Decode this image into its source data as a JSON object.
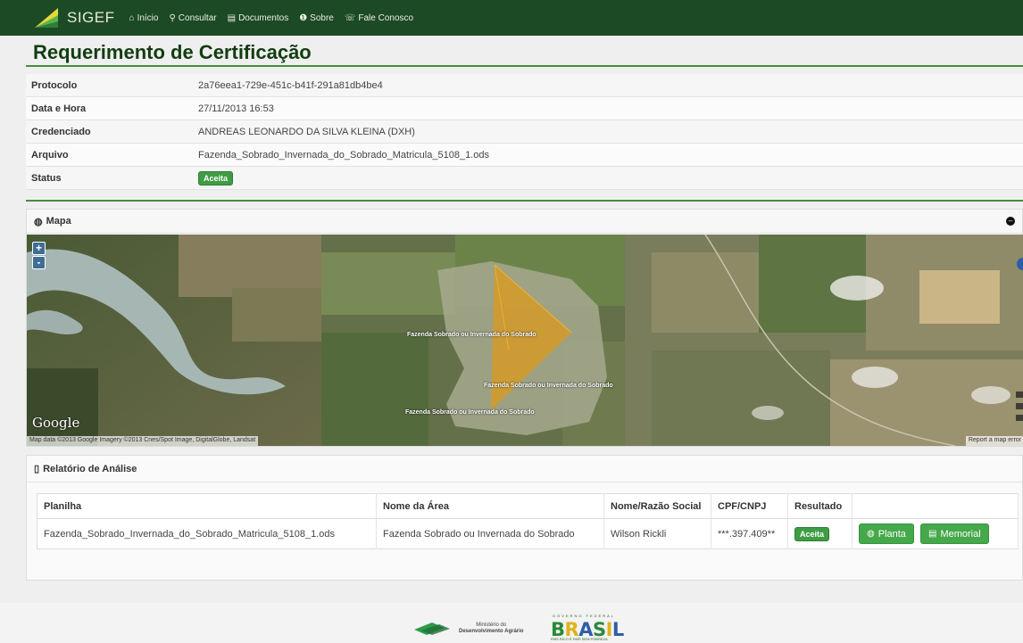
{
  "nav": {
    "brand": "SIGEF",
    "items": [
      {
        "icon": "home-icon",
        "glyph": "⌂",
        "label": "Início"
      },
      {
        "icon": "search-icon",
        "glyph": "⚲",
        "label": "Consultar"
      },
      {
        "icon": "document-icon",
        "glyph": "▤",
        "label": "Documentos"
      },
      {
        "icon": "info-icon",
        "glyph": "❶",
        "label": "Sobre"
      },
      {
        "icon": "phone-icon",
        "glyph": "☏",
        "label": "Fale Conosco"
      }
    ]
  },
  "page_title": "Requerimento de Certificação",
  "info": {
    "protocolo": {
      "label": "Protocolo",
      "value": "2a76eea1-729e-451c-b41f-291a81db4be4"
    },
    "data_hora": {
      "label": "Data e Hora",
      "value": "27/11/2013 16:53"
    },
    "credenciado": {
      "label": "Credenciado",
      "value": "ANDREAS LEONARDO DA SILVA KLEINA (DXH)"
    },
    "arquivo": {
      "label": "Arquivo",
      "value": "Fazenda_Sobrado_Invernada_do_Sobrado_Matricula_5108_1.ods"
    },
    "status": {
      "label": "Status",
      "value": "Aceita"
    }
  },
  "map": {
    "title": "Mapa",
    "zoom_in": "+",
    "zoom_out": "-",
    "google": "Google",
    "credit": "Map data ©2013 Google Imagery ©2013 Cnes/Spot Image, DigitalGlobe, Landsat",
    "report": "Report a map error",
    "labels": [
      "Fazenda Sobrado ou Invernada do Sobrado",
      "Fazenda Sobrado ou Invernada do Sobrado",
      "Fazenda Sobrado ou Invernada do Sobrado"
    ]
  },
  "report": {
    "title": "Relatório de Análise",
    "headers": [
      "Planilha",
      "Nome da Área",
      "Nome/Razão Social",
      "CPF/CNPJ",
      "Resultado"
    ],
    "row": {
      "planilha": "Fazenda_Sobrado_Invernada_do_Sobrado_Matricula_5108_1.ods",
      "nome_area": "Fazenda Sobrado ou Invernada do Sobrado",
      "razao_social": "Wilson Rickli",
      "cpf_cnpj": "***.397.409**",
      "resultado": "Aceita"
    },
    "buttons": {
      "planta": "Planta",
      "memorial": "Memorial"
    }
  },
  "footer": {
    "mda": [
      "Ministério do",
      "Desenvolvimento Agrário"
    ],
    "brasil_top": "GOVERNO FEDERAL",
    "brasil": "BRASIL",
    "brasil_bottom": "PAÍS RICO É PAÍS SEM POBREZA"
  },
  "colors": {
    "nav": "#1c4a24",
    "title": "#123d12",
    "accent": "#4a8a3f",
    "badge": "#3f9c44",
    "button": "#45a84a"
  }
}
